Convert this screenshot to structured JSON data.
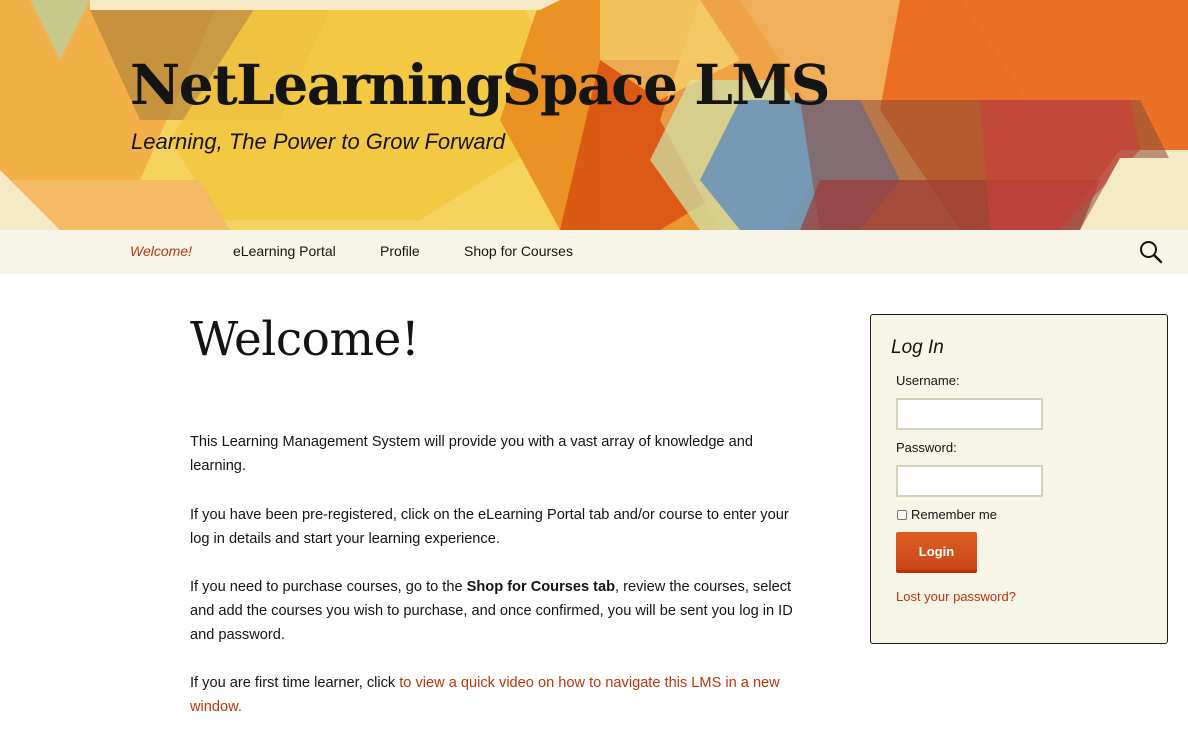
{
  "site": {
    "title": "NetLearningSpace LMS",
    "tagline": "Learning, The Power to Grow Forward"
  },
  "nav": {
    "items": [
      {
        "label": "Welcome!",
        "active": true
      },
      {
        "label": "eLearning Portal",
        "active": false
      },
      {
        "label": "Profile",
        "active": false
      },
      {
        "label": "Shop for Courses",
        "active": false
      }
    ],
    "search_icon": "search-icon"
  },
  "main": {
    "title": "Welcome!",
    "paragraphs": {
      "p1": "This Learning Management System will provide you with a vast array of knowledge and learning.",
      "p2": "If you have been pre-registered, click on the eLearning Portal tab and/or course to enter your log in details and start your learning experience.",
      "p3_before": "If you need to purchase courses, go to the ",
      "p3_bold": "Shop for Courses tab",
      "p3_after": ", review the courses, select and add the courses you wish  to purchase, and once confirmed, you will be sent you log in ID and password.",
      "p4_before": "If you are first time learner, click ",
      "p4_link": "to view a quick video on how to navigate this LMS in a new window."
    }
  },
  "login": {
    "title": "Log In",
    "username_label": "Username:",
    "username_value": "",
    "password_label": "Password:",
    "password_value": "",
    "remember_label": "Remember me",
    "remember_checked": false,
    "button_label": "Login",
    "lost_password_label": "Lost your password?"
  },
  "colors": {
    "accent": "#bc360a",
    "button": "#e05d22",
    "nav_background": "#f7f5e7",
    "widget_background": "#f7f5e7"
  }
}
